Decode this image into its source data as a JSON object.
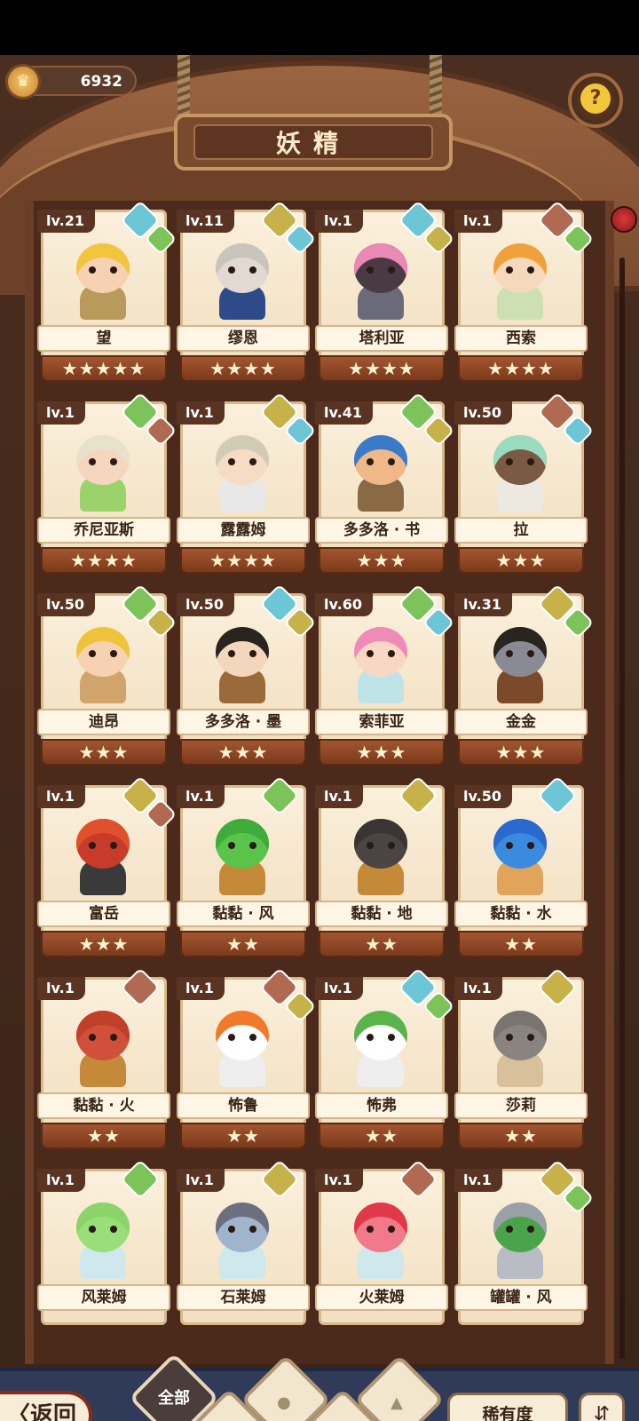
{
  "header": {
    "currency_value": "6932",
    "currency_icon": "crown-coin-icon",
    "title": "妖精",
    "help_icon": "question-sprout-icon"
  },
  "fairies": [
    {
      "level": "lv.21",
      "name": "望",
      "stars": 5,
      "elements": [
        "water",
        "wind"
      ],
      "hair": "#f3c43e",
      "skin": "#f6d2b2",
      "outfit": "#b89a5a"
    },
    {
      "level": "lv.11",
      "name": "缪恩",
      "stars": 4,
      "elements": [
        "earth",
        "water"
      ],
      "hair": "#c9c4bc",
      "skin": "#e0dad2",
      "outfit": "#2d4a8a"
    },
    {
      "level": "lv.1",
      "name": "塔利亚",
      "stars": 4,
      "elements": [
        "water",
        "earth"
      ],
      "hair": "#ea88b6",
      "skin": "#4a3a44",
      "outfit": "#6a6a7a"
    },
    {
      "level": "lv.1",
      "name": "西索",
      "stars": 4,
      "elements": [
        "fire",
        "wind"
      ],
      "hair": "#f0a23a",
      "skin": "#f6d8bc",
      "outfit": "#cde0b4"
    },
    {
      "level": "lv.1",
      "name": "乔尼亚斯",
      "stars": 4,
      "elements": [
        "wind",
        "fire"
      ],
      "hair": "#e8e2cc",
      "skin": "#f6d6bc",
      "outfit": "#9ad36a"
    },
    {
      "level": "lv.1",
      "name": "露露姆",
      "stars": 4,
      "elements": [
        "earth",
        "water"
      ],
      "hair": "#d0ccb6",
      "skin": "#f6dcc4",
      "outfit": "#e8e8e8"
    },
    {
      "level": "lv.41",
      "name": "多多洛 · 书",
      "stars": 3,
      "elements": [
        "wind",
        "earth"
      ],
      "hair": "#3a7ac8",
      "skin": "#f0b888",
      "outfit": "#8a6a44"
    },
    {
      "level": "lv.50",
      "name": "拉",
      "stars": 3,
      "elements": [
        "fire",
        "water"
      ],
      "hair": "#9adcc0",
      "skin": "#7a5a44",
      "outfit": "#eceae0"
    },
    {
      "level": "lv.50",
      "name": "迪昂",
      "stars": 3,
      "elements": [
        "wind",
        "earth"
      ],
      "hair": "#f0c43a",
      "skin": "#f6d2b2",
      "outfit": "#d0a46a"
    },
    {
      "level": "lv.50",
      "name": "多多洛 · 墨",
      "stars": 3,
      "elements": [
        "water",
        "earth"
      ],
      "hair": "#2a2420",
      "skin": "#f4d6bc",
      "outfit": "#9a6a3a"
    },
    {
      "level": "lv.60",
      "name": "索菲亚",
      "stars": 3,
      "elements": [
        "wind",
        "water"
      ],
      "hair": "#f08ab8",
      "skin": "#f8d8c4",
      "outfit": "#bfe4e8"
    },
    {
      "level": "lv.31",
      "name": "金金",
      "stars": 3,
      "elements": [
        "earth",
        "wind"
      ],
      "hair": "#2a2420",
      "skin": "#8a8a94",
      "outfit": "#7a4a2a"
    },
    {
      "level": "lv.1",
      "name": "富岳",
      "stars": 3,
      "elements": [
        "earth",
        "fire"
      ],
      "hair": "#e0502a",
      "skin": "#c83a2a",
      "outfit": "#3a3a3a"
    },
    {
      "level": "lv.1",
      "name": "黏黏 · 风",
      "stars": 2,
      "elements": [
        "wind"
      ],
      "hair": "#3eac3a",
      "skin": "#5ac44a",
      "outfit": "#c48a3a"
    },
    {
      "level": "lv.1",
      "name": "黏黏 · 地",
      "stars": 2,
      "elements": [
        "earth"
      ],
      "hair": "#3a3434",
      "skin": "#4a4444",
      "outfit": "#c48a3a"
    },
    {
      "level": "lv.50",
      "name": "黏黏 · 水",
      "stars": 2,
      "elements": [
        "water"
      ],
      "hair": "#2a6ad0",
      "skin": "#3a8ae0",
      "outfit": "#e0a45a"
    },
    {
      "level": "lv.1",
      "name": "黏黏 · 火",
      "stars": 2,
      "elements": [
        "fire"
      ],
      "hair": "#c0402a",
      "skin": "#d0503a",
      "outfit": "#c48a3a"
    },
    {
      "level": "lv.1",
      "name": "怖鲁",
      "stars": 2,
      "elements": [
        "fire",
        "earth"
      ],
      "hair": "#f07a2a",
      "skin": "#ffffff",
      "outfit": "#eeeeee"
    },
    {
      "level": "lv.1",
      "name": "怖弗",
      "stars": 2,
      "elements": [
        "water",
        "wind"
      ],
      "hair": "#5ab44a",
      "skin": "#ffffff",
      "outfit": "#eeeeee"
    },
    {
      "level": "lv.1",
      "name": "莎莉",
      "stars": 2,
      "elements": [
        "earth"
      ],
      "hair": "#7a7470",
      "skin": "#8a8480",
      "outfit": "#d8c09a"
    },
    {
      "level": "lv.1",
      "name": "风莱姆",
      "stars": 0,
      "elements": [
        "wind"
      ],
      "hair": "#8ad46a",
      "skin": "#9ade7a",
      "outfit": "#cfe8ee"
    },
    {
      "level": "lv.1",
      "name": "石莱姆",
      "stars": 0,
      "elements": [
        "earth"
      ],
      "hair": "#6a7080",
      "skin": "#a0b4cc",
      "outfit": "#cfe8ee"
    },
    {
      "level": "lv.1",
      "name": "火莱姆",
      "stars": 0,
      "elements": [
        "fire"
      ],
      "hair": "#e03a4a",
      "skin": "#f07a8a",
      "outfit": "#cfe8ee"
    },
    {
      "level": "lv.1",
      "name": "罐罐 · 风",
      "stars": 0,
      "elements": [
        "earth",
        "wind"
      ],
      "hair": "#9aa0a8",
      "skin": "#4aa44a",
      "outfit": "#b8bcc4"
    }
  ],
  "bottom_bar": {
    "back_label": "〈返回",
    "filter_all_label": "全部",
    "filter_icons": [
      "wind-sprout-icon",
      "water-drop-icon",
      "earth-mountain-icon",
      "fire-mountain-icon"
    ],
    "sort_label": "稀有度",
    "order_icon": "sort-order-icon"
  }
}
